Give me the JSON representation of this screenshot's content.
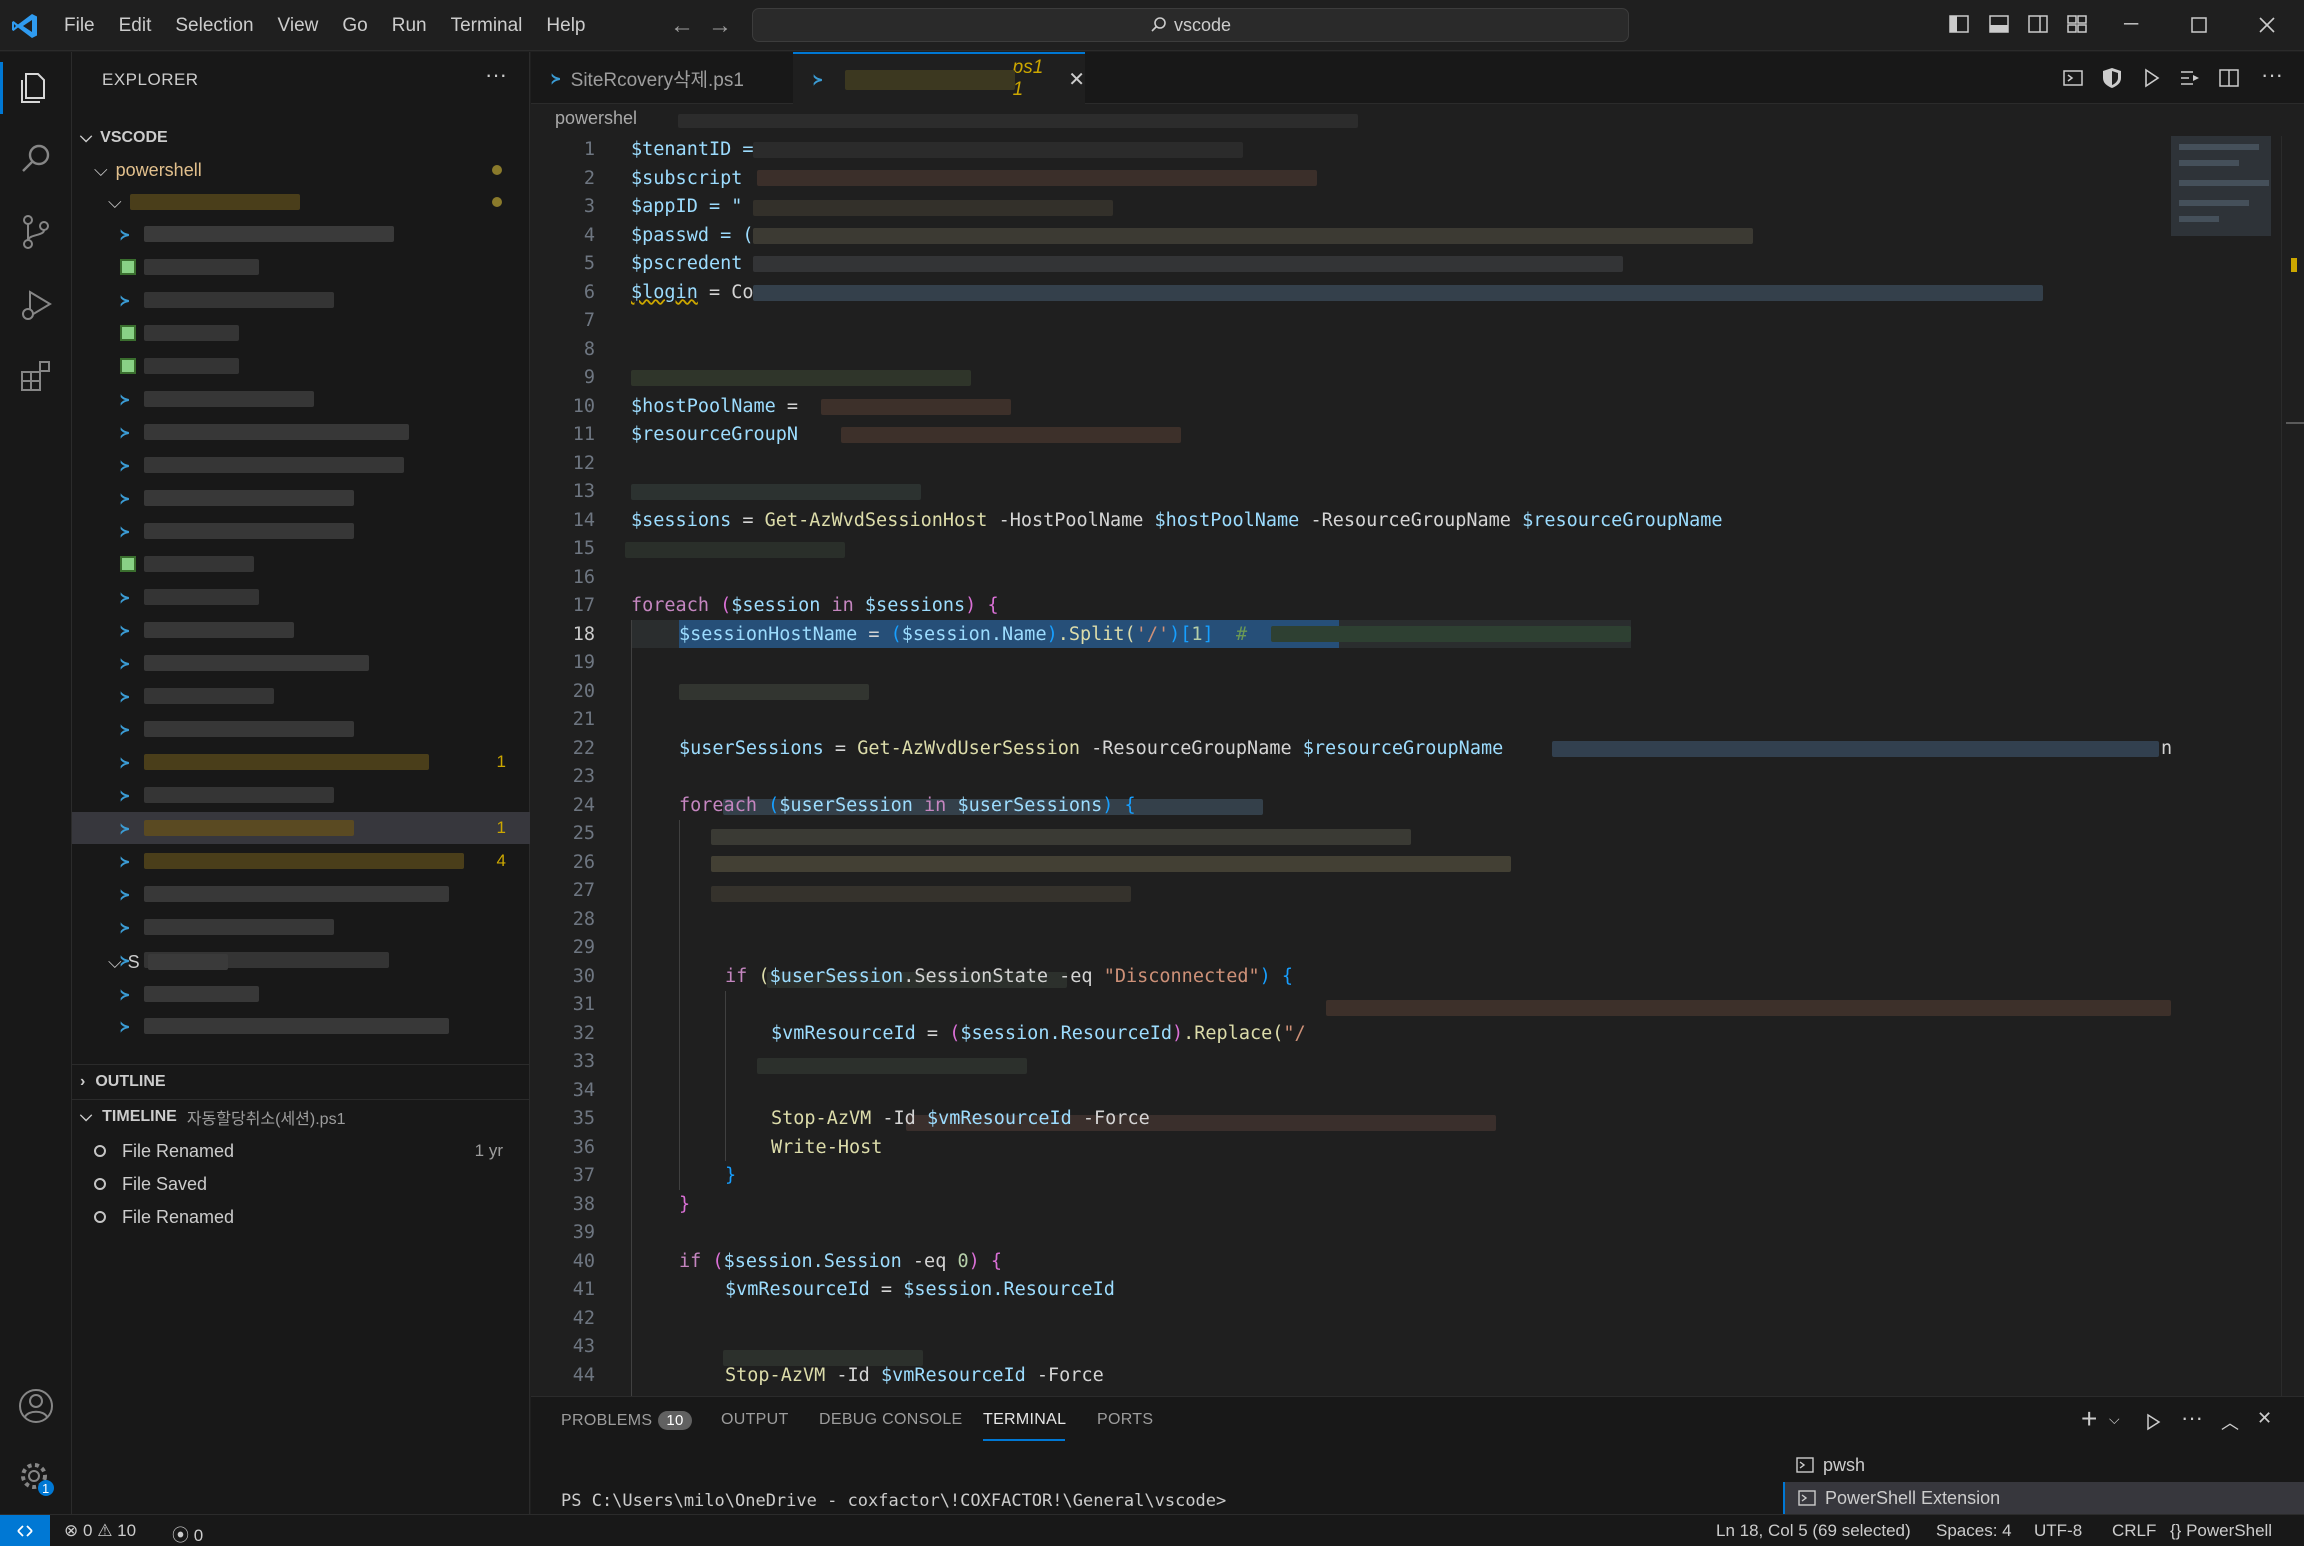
{
  "menu": [
    "File",
    "Edit",
    "Selection",
    "View",
    "Go",
    "Run",
    "Terminal",
    "Help"
  ],
  "search": {
    "label": "vscode"
  },
  "sidebar": {
    "title": "EXPLORER",
    "root": "VSCODE",
    "folder": "powershell",
    "subfolder2": "S",
    "problem_counts": [
      "1",
      "1",
      "4"
    ]
  },
  "outline": {
    "title": "OUTLINE"
  },
  "timeline": {
    "title": "TIMELINE",
    "file": "자동할당취소(세션).ps1",
    "items": [
      {
        "label": "File Renamed",
        "time": "1 yr"
      },
      {
        "label": "File Saved",
        "time": ""
      },
      {
        "label": "File Renamed",
        "time": ""
      }
    ]
  },
  "tabs": [
    {
      "label": "SiteRcovery삭제.ps1"
    },
    {
      "label": "ps1 1"
    }
  ],
  "breadcrumb": "powershel",
  "code": {
    "l1": "$tenantID =",
    "l2": "$subscript",
    "l3a": "$appID = \"",
    "l4": "$passwd = (",
    "l5": "$pscredent",
    "l6a": "$login",
    "l6b": " = Co",
    "l10a": "$hostPoolName",
    "l10b": " =",
    "l11": "$resourceGroupN",
    "l14": [
      "$sessions",
      " = ",
      "Get-AzWvdSessionHost",
      " -HostPoolName ",
      "$hostPoolName",
      " -ResourceGroupName ",
      "$resourceGroupName"
    ],
    "l17": [
      "foreach",
      " (",
      "$session",
      " in ",
      "$sessions",
      ") {"
    ],
    "l18": [
      "$sessionHostName",
      " = ",
      "(",
      "$session",
      ".Name",
      ")",
      ".Split(",
      "'/'",
      ")[",
      "1",
      "]",
      "  #"
    ],
    "l21": [
      "$userSessions",
      " = ",
      "Get-AzWvdUserSession",
      " -ResourceGroupName ",
      "$resourceGroupName",
      "nH"
    ],
    "l23": [
      "foreach",
      " (",
      "$userSession",
      " in ",
      "$userSessions",
      ") {"
    ],
    "l29": [
      "if",
      " (",
      "$userSession",
      ".SessionState",
      " -eq ",
      "\"Disconnected\"",
      ") {"
    ],
    "l31": [
      "$vmResourceId",
      " = ",
      "(",
      "$session",
      ".ResourceId",
      ")",
      ".Replace(",
      "\"/"
    ],
    "l34": [
      "Stop-AzVM",
      " -Id ",
      "$vmResourceId",
      " -Force"
    ],
    "l35": [
      "Write-Host"
    ],
    "l36": "}",
    "l37": "}",
    "l39": [
      "if",
      " (",
      "$session",
      ".Session",
      " -eq ",
      "0",
      ") {"
    ],
    "l40": [
      "$vmResourceId",
      " = ",
      "$session",
      ".ResourceId"
    ],
    "l43": [
      "Stop-AzVM",
      " -Id ",
      "$vmResourceId",
      " -Force"
    ],
    "line_numbers": [
      "1",
      "2",
      "3",
      "4",
      "5",
      "6",
      "7",
      "8",
      "9",
      "10",
      "11",
      "12",
      "13",
      "14",
      "15",
      "16",
      "17",
      "18",
      "19",
      "20",
      "21",
      "22",
      "23",
      "24",
      "25",
      "26",
      "27",
      "28",
      "29",
      "30",
      "31",
      "32",
      "33",
      "34",
      "35",
      "36",
      "37",
      "38",
      "39",
      "40",
      "41",
      "42",
      "43",
      "44"
    ],
    "current_line": "18"
  },
  "panel": {
    "tabs": [
      "PROBLEMS",
      "OUTPUT",
      "DEBUG CONSOLE",
      "TERMINAL",
      "PORTS"
    ],
    "problems_badge": "10",
    "terminal_prompt": "PS C:\\Users\\milo\\OneDrive - coxfactor\\!COXFACTOR!\\General\\vscode>",
    "terminals": [
      "pwsh",
      "PowerShell Extension"
    ]
  },
  "status": {
    "errors": "0",
    "warnings": "10",
    "ports": "0",
    "position": "Ln 18, Col 5 (69 selected)",
    "spaces": "Spaces: 4",
    "encoding": "UTF-8",
    "eol": "CRLF",
    "language": "PowerShell",
    "accounts_badge": "1"
  },
  "colors": {
    "accent": "#0078d4",
    "warning": "#cca700",
    "folder": "#e2c08d"
  }
}
